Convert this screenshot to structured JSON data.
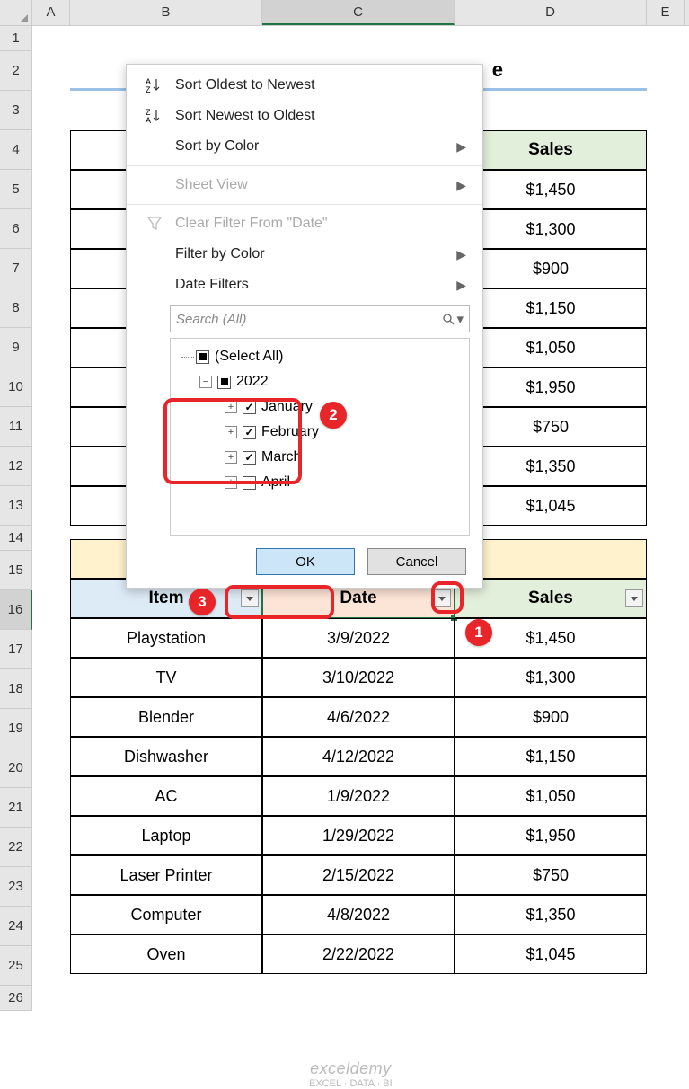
{
  "columns": {
    "A": "A",
    "B": "B",
    "C": "C",
    "D": "D",
    "E": "E"
  },
  "row_numbers": [
    "1",
    "2",
    "3",
    "4",
    "5",
    "6",
    "7",
    "8",
    "9",
    "10",
    "11",
    "12",
    "13",
    "14",
    "15",
    "16",
    "17",
    "18",
    "19",
    "20",
    "21",
    "22",
    "23",
    "24",
    "25",
    "26"
  ],
  "title_partial": "e",
  "top_table": {
    "headers": {
      "sales": "Sales"
    },
    "sales": [
      "$1,450",
      "$1,300",
      "$900",
      "$1,150",
      "$1,050",
      "$1,950",
      "$750",
      "$1,350",
      "$1,045"
    ]
  },
  "bottom_table": {
    "headers": {
      "item": "Item",
      "date": "Date",
      "sales": "Sales"
    },
    "rows": [
      {
        "item": "Playstation",
        "date": "3/9/2022",
        "sales": "$1,450"
      },
      {
        "item": "TV",
        "date": "3/10/2022",
        "sales": "$1,300"
      },
      {
        "item": "Blender",
        "date": "4/6/2022",
        "sales": "$900"
      },
      {
        "item": "Dishwasher",
        "date": "4/12/2022",
        "sales": "$1,150"
      },
      {
        "item": "AC",
        "date": "1/9/2022",
        "sales": "$1,050"
      },
      {
        "item": "Laptop",
        "date": "1/29/2022",
        "sales": "$1,950"
      },
      {
        "item": "Laser Printer",
        "date": "2/15/2022",
        "sales": "$750"
      },
      {
        "item": "Computer",
        "date": "4/8/2022",
        "sales": "$1,350"
      },
      {
        "item": "Oven",
        "date": "2/22/2022",
        "sales": "$1,045"
      }
    ]
  },
  "menu": {
    "sort_oldest": "Sort Oldest to Newest",
    "sort_newest": "Sort Newest to Oldest",
    "sort_by_color": "Sort by Color",
    "sheet_view": "Sheet View",
    "clear_filter": "Clear Filter From \"Date\"",
    "filter_by_color": "Filter by Color",
    "date_filters": "Date Filters",
    "search_placeholder": "Search (All)",
    "select_all": "(Select All)",
    "year": "2022",
    "months": {
      "jan": "January",
      "feb": "February",
      "mar": "March",
      "apr": "April"
    },
    "ok": "OK",
    "cancel": "Cancel"
  },
  "badges": {
    "b1": "1",
    "b2": "2",
    "b3": "3"
  },
  "watermark": {
    "brand": "exceldemy",
    "tag": "EXCEL · DATA · BI"
  }
}
